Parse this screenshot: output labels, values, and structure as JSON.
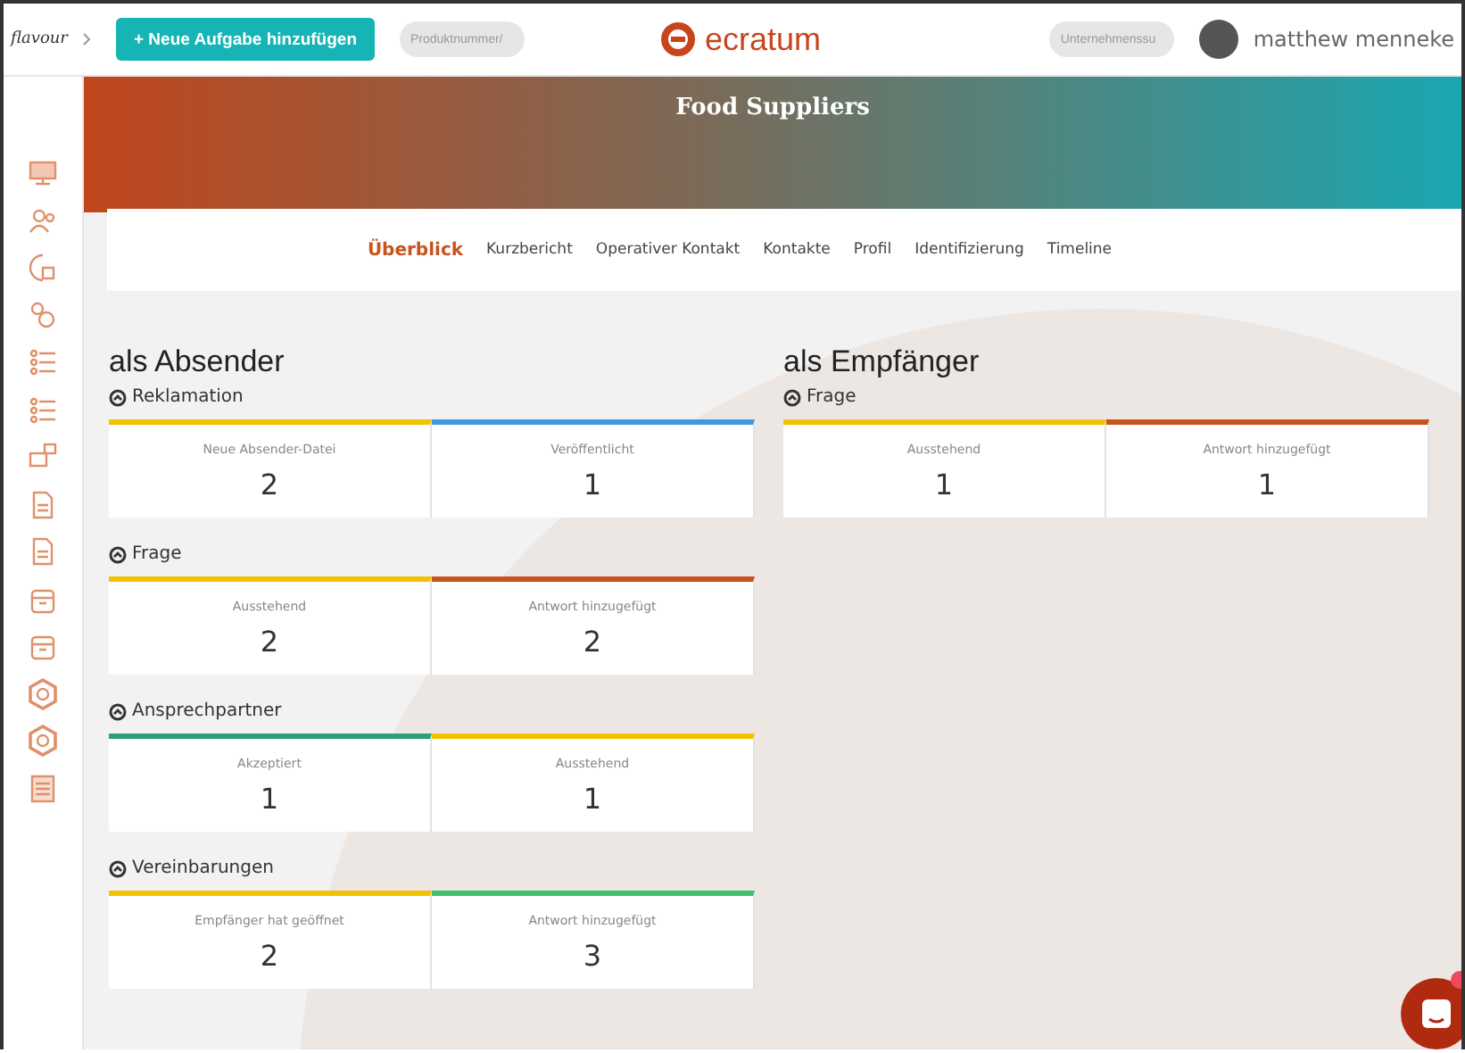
{
  "topbar": {
    "logo": "flavour",
    "new_task_button": "+ Neue Aufgabe hinzufügen",
    "product_field": {
      "placeholder": "Produktnummer/"
    },
    "brand": "ecratum",
    "company_field": {
      "placeholder": "Unternehmenssu"
    },
    "user": "matthew menneke"
  },
  "banner": {
    "title": "Food Suppliers"
  },
  "tabs": [
    {
      "label": "Überblick",
      "selected": true
    },
    {
      "label": "Kurzbericht",
      "selected": false
    },
    {
      "label": "Operativer Kontakt",
      "selected": false
    },
    {
      "label": "Kontakte",
      "selected": false
    },
    {
      "label": "Profil",
      "selected": false
    },
    {
      "label": "Identifizierung",
      "selected": false
    },
    {
      "label": "Timeline",
      "selected": false
    }
  ],
  "columns": [
    {
      "title": "als Absender",
      "groups": [
        {
          "title": "Reklamation",
          "cards": [
            {
              "label": "Neue Absender-Datei",
              "value": "2",
              "color": "#f2c200"
            },
            {
              "label": "Veröffentlicht",
              "value": "1",
              "color": "#3d9ae0"
            }
          ]
        },
        {
          "title": "Frage",
          "cards": [
            {
              "label": "Ausstehend",
              "value": "2",
              "color": "#f2c200"
            },
            {
              "label": "Antwort hinzugefügt",
              "value": "2",
              "color": "#c8531f"
            }
          ]
        },
        {
          "title": "Ansprechpartner",
          "cards": [
            {
              "label": "Akzeptiert",
              "value": "1",
              "color": "#2aa07a"
            },
            {
              "label": "Ausstehend",
              "value": "1",
              "color": "#f2c200"
            }
          ]
        },
        {
          "title": "Vereinbarungen",
          "cards": [
            {
              "label": "Empfänger hat geöffnet",
              "value": "2",
              "color": "#f2c200"
            },
            {
              "label": "Antwort hinzugefügt",
              "value": "3",
              "color": "#3cc06a"
            }
          ]
        }
      ]
    },
    {
      "title": "als Empfänger",
      "groups": [
        {
          "title": "Frage",
          "cards": [
            {
              "label": "Ausstehend",
              "value": "1",
              "color": "#f2c200"
            },
            {
              "label": "Antwort hinzugefügt",
              "value": "1",
              "color": "#c8531f"
            }
          ]
        }
      ]
    }
  ]
}
